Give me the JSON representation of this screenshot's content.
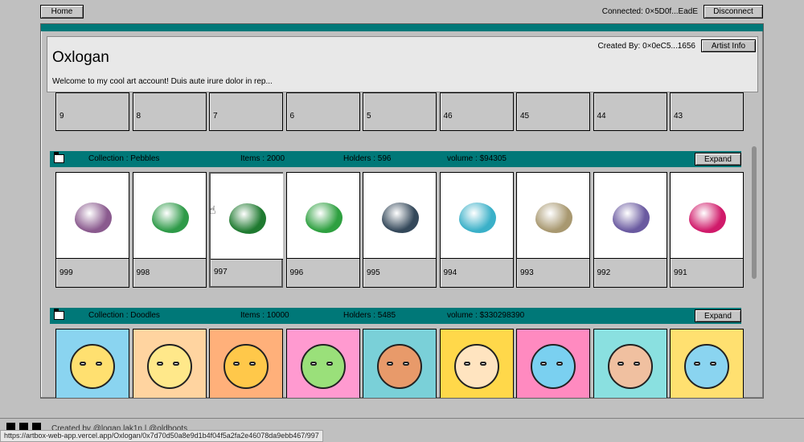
{
  "topbar": {
    "home_label": "Home",
    "connected_label": "Connected: 0×5D0f...EadE",
    "disconnect_label": "Disconnect"
  },
  "profile": {
    "artist_name": "Oxlogan",
    "bio": "Welcome to my cool art account! Duis aute irure dolor in rep...",
    "created_by": "Created By: 0×0eC5...1656",
    "artist_info_label": "Artist Info"
  },
  "previous_row": {
    "numbers": [
      "9",
      "8",
      "7",
      "6",
      "5",
      "46",
      "45",
      "44",
      "43"
    ],
    "colors": [
      "#ffffff",
      "#ffffff",
      "#ffffff",
      "#ffffff",
      "#ffffff",
      "#4a2e1c",
      "#6b4a30",
      "#1e2ba3",
      "#c27a3a"
    ]
  },
  "collections": [
    {
      "collection": "Collection : Pebbles",
      "items": "Items : 2000",
      "holders": "Holders : 596",
      "volume": "volume : $94305",
      "expand_label": "Expand",
      "cards": [
        {
          "num": "999",
          "color": "#8a5a8e"
        },
        {
          "num": "998",
          "color": "#2e9a48"
        },
        {
          "num": "997",
          "color": "#1f7a30"
        },
        {
          "num": "996",
          "color": "#2ea040"
        },
        {
          "num": "995",
          "color": "#34485a"
        },
        {
          "num": "994",
          "color": "#3ab0c8"
        },
        {
          "num": "993",
          "color": "#a89870"
        },
        {
          "num": "992",
          "color": "#6a5aa0"
        },
        {
          "num": "991",
          "color": "#d01a6a"
        }
      ]
    },
    {
      "collection": "Collection : Doodles",
      "items": "Items : 10000",
      "holders": "Holders : 5485",
      "volume": "volume : $330298390",
      "expand_label": "Expand",
      "cards": [
        {
          "bg": "#8ad4f0",
          "skin": "#ffe070"
        },
        {
          "bg": "#ffd4a0",
          "skin": "#ffe88a"
        },
        {
          "bg": "#ffb07a",
          "skin": "#ffc84a"
        },
        {
          "bg": "#ff9ad0",
          "skin": "#9ae07a"
        },
        {
          "bg": "#7ad0d8",
          "skin": "#e89a6a"
        },
        {
          "bg": "#ffd84a",
          "skin": "#ffe4c0"
        },
        {
          "bg": "#ff8ac0",
          "skin": "#7ad0f0"
        },
        {
          "bg": "#8ae0e0",
          "skin": "#f0c0a0"
        },
        {
          "bg": "#ffe070",
          "skin": "#8ad4f0"
        }
      ]
    }
  ],
  "status_url": "https://artbox-web-app.vercel.app/Oxlogan/0x7d70d50a8e9d1b4f04f5a2fa2e46078da9ebb467/997",
  "footer_text": "Created by @logan.lak1n | @oldboots"
}
